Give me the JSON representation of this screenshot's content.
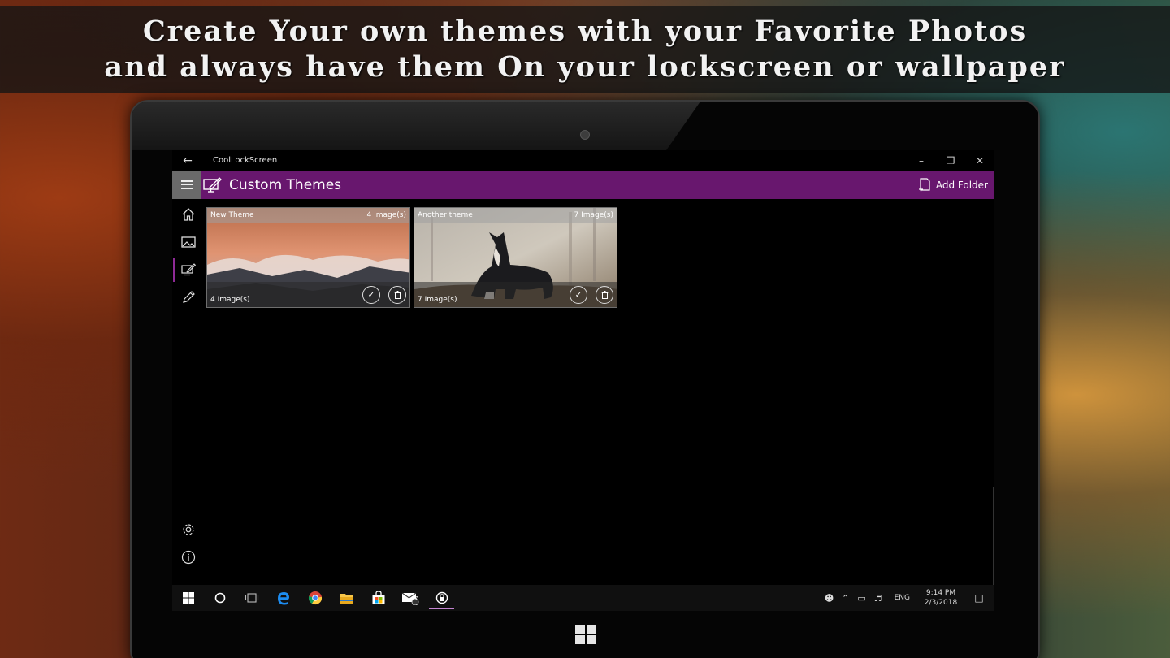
{
  "banner": {
    "line1": "Create Your own themes with your Favorite Photos",
    "line2": "and always have them On your lockscreen or wallpaper"
  },
  "app": {
    "title": "CoolLockScreen",
    "header_title": "Custom Themes",
    "add_folder_label": "Add Folder"
  },
  "themes": [
    {
      "name": "New Theme",
      "count_top": "4 Image(s)",
      "count_bottom": "4 Image(s)"
    },
    {
      "name": "Another theme",
      "count_top": "7 Image(s)",
      "count_bottom": "7 Image(s)"
    }
  ],
  "sidebar": {
    "items": [
      "home-icon",
      "image-icon",
      "custom-themes-icon",
      "pencil-icon"
    ],
    "active_index": 2,
    "bottom": [
      "settings-icon",
      "info-icon"
    ]
  },
  "taskbar": {
    "mail_badge": "7",
    "lang": "ENG",
    "time": "9:14 PM",
    "date": "2/3/2018"
  },
  "colors": {
    "accent": "#68176e",
    "active_indicator": "#8e2a96"
  }
}
